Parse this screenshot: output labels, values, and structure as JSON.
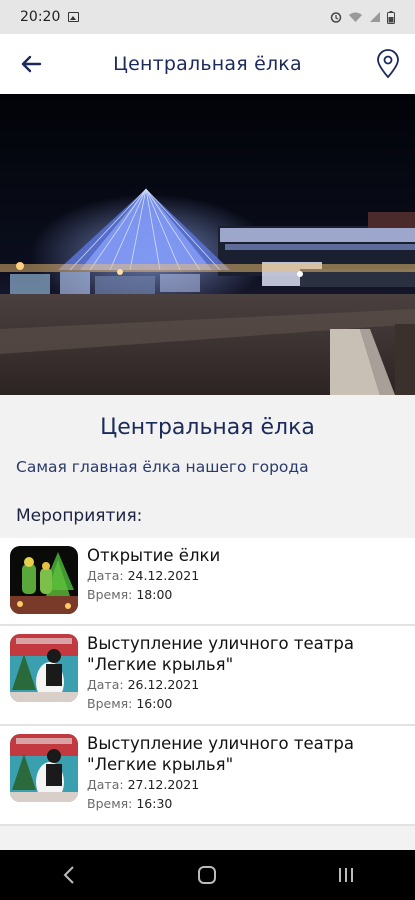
{
  "status_bar": {
    "time": "20:20",
    "icons": [
      "gallery-icon",
      "alarm-icon",
      "wifi-icon",
      "signal-icon",
      "battery-icon"
    ]
  },
  "app_bar": {
    "title": "Центральная ёлка",
    "back_icon": "arrow-left-icon",
    "location_icon": "map-pin-icon"
  },
  "place": {
    "title": "Центральная ёлка",
    "description": "Самая главная ёлка нашего города"
  },
  "events": {
    "heading": "Мероприятия:",
    "date_label": "Дата:",
    "time_label": "Время:",
    "items": [
      {
        "title": "Открытие ёлки",
        "date": "24.12.2021",
        "time": "18:00"
      },
      {
        "title": "Выступление уличного театра \"Легкие крылья\"",
        "date": "26.12.2021",
        "time": "16:00"
      },
      {
        "title": "Выступление уличного театра \"Легкие крылья\"",
        "date": "27.12.2021",
        "time": "16:30"
      }
    ]
  },
  "nav_bar": {
    "icons": [
      "back-nav-icon",
      "home-nav-icon",
      "recents-nav-icon"
    ]
  },
  "colors": {
    "primary_text": "#1c2a5a",
    "background": "#f2f2f2",
    "card": "#ffffff"
  }
}
